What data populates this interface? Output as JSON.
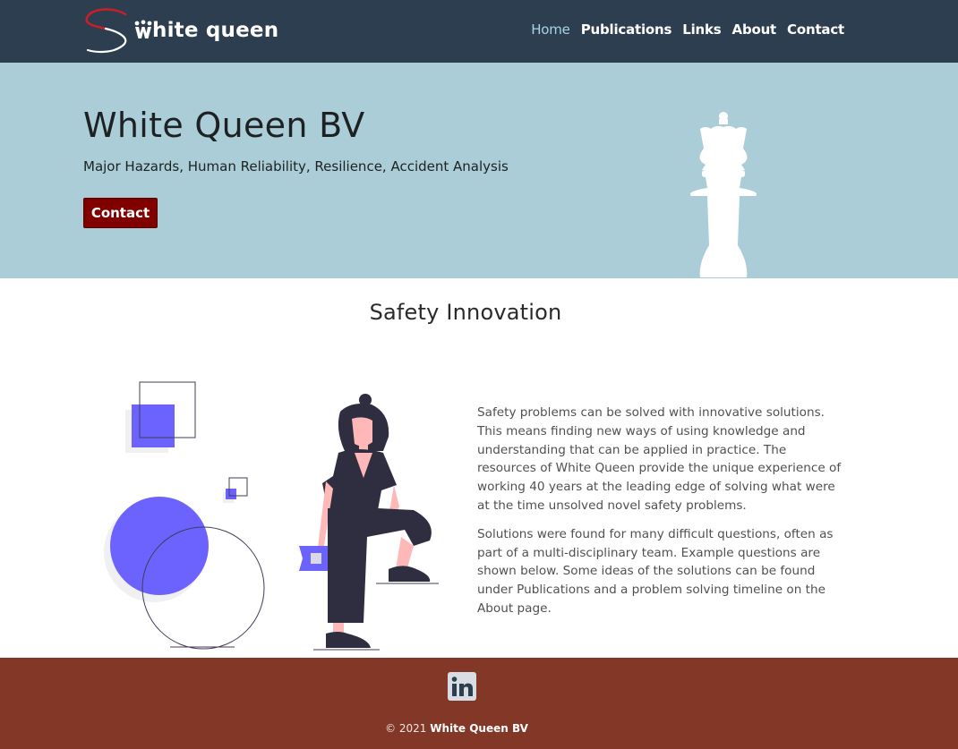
{
  "header": {
    "brand_name": "hite queen",
    "brand_initial": "W",
    "nav": [
      {
        "label": "Home",
        "active": true
      },
      {
        "label": "Publications",
        "active": false
      },
      {
        "label": "Links",
        "active": false
      },
      {
        "label": "About",
        "active": false
      },
      {
        "label": "Contact",
        "active": false
      }
    ]
  },
  "hero": {
    "title": "White Queen BV",
    "subtitle": "Major Hazards, Human Reliability, Resilience, Accident Analysis",
    "button_label": "Contact",
    "icon": "chess-queen-icon"
  },
  "section": {
    "title": "Safety Innovation",
    "illustration": "person-with-shapes-illustration",
    "paragraphs": [
      "Safety problems can be solved with innovative solutions. This means finding new ways of using knowledge and understanding that can be applied in practice. The resources of White Queen provide the unique experience of working 40 years at the leading edge of solving what were at the time unsolved novel safety problems.",
      "Solutions were found for many difficult questions, often as part of a multi-disciplinary team. Example questions are shown below. Some ideas of the solutions can be found under Publications and a problem solving timeline on the About page."
    ]
  },
  "footer": {
    "copyright_prefix": "© 2021",
    "copyright_name": "White Queen BV",
    "social_icon": "linkedin-icon"
  },
  "colors": {
    "header_bg": "#2d3e50",
    "hero_bg": "#abcdd7",
    "button_bg": "#800000",
    "accent": "#6c63ff",
    "footer_bg": "#833726",
    "nav_active": "#a9d3e8"
  }
}
